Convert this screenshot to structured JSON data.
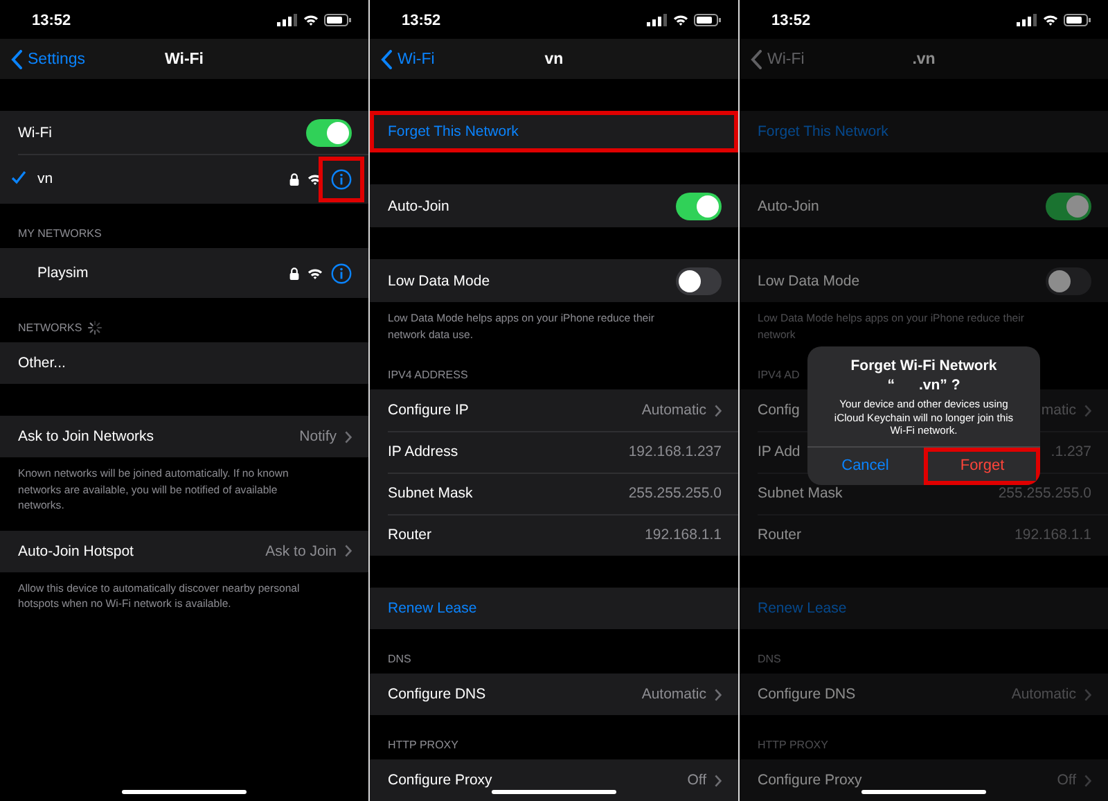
{
  "panels": [
    {
      "status": {
        "time": "13:52"
      },
      "nav": {
        "back": "Settings",
        "title": "Wi-Fi",
        "disabled": false
      },
      "dimmed": false,
      "sections": [
        {
          "rows": [
            {
              "kind": "toggle",
              "label": "Wi-Fi",
              "on": true
            },
            {
              "kind": "network",
              "label": "vn",
              "checked": true,
              "locked": true,
              "info_highlighted": true
            }
          ]
        },
        {
          "header": "MY NETWORKS",
          "rows": [
            {
              "kind": "network",
              "label": "Playsim",
              "checked": false,
              "locked": true,
              "info_highlighted": false
            }
          ]
        },
        {
          "header": "NETWORKS",
          "loading": true,
          "rows": [
            {
              "kind": "plain",
              "label": "Other..."
            }
          ]
        },
        {
          "rows": [
            {
              "kind": "nav",
              "label": "Ask to Join Networks",
              "value": "Notify"
            }
          ],
          "footer": "Known networks will be joined automatically. If no known\nnetworks are available, you will be notified of available\nnetworks."
        },
        {
          "rows": [
            {
              "kind": "nav",
              "label": "Auto-Join Hotspot",
              "value": "Ask to Join"
            }
          ],
          "footer": "Allow this device to automatically discover nearby personal\nhotspots when no Wi-Fi network is available."
        }
      ]
    },
    {
      "status": {
        "time": "13:52"
      },
      "nav": {
        "back": "Wi-Fi",
        "title": "vn",
        "disabled": false
      },
      "dimmed": false,
      "sections": [
        {
          "rows": [
            {
              "kind": "action",
              "label": "Forget This Network",
              "highlighted": true
            }
          ]
        },
        {
          "rows": [
            {
              "kind": "toggle",
              "label": "Auto-Join",
              "on": true
            }
          ]
        },
        {
          "rows": [
            {
              "kind": "toggle",
              "label": "Low Data Mode",
              "on": false
            }
          ],
          "footer": "Low Data Mode helps apps on your iPhone reduce their\nnetwork data use."
        },
        {
          "header": "IPV4 ADDRESS",
          "rows": [
            {
              "kind": "nav",
              "label": "Configure IP",
              "value": "Automatic"
            },
            {
              "kind": "value",
              "label": "IP Address",
              "value": "192.168.1.237"
            },
            {
              "kind": "value",
              "label": "Subnet Mask",
              "value": "255.255.255.0"
            },
            {
              "kind": "value",
              "label": "Router",
              "value": "192.168.1.1"
            }
          ]
        },
        {
          "rows": [
            {
              "kind": "action",
              "label": "Renew Lease",
              "highlighted": false
            }
          ]
        },
        {
          "header": "DNS",
          "rows": [
            {
              "kind": "nav",
              "label": "Configure DNS",
              "value": "Automatic"
            }
          ]
        },
        {
          "header": "HTTP PROXY",
          "rows": [
            {
              "kind": "nav",
              "label": "Configure Proxy",
              "value": "Off"
            }
          ]
        }
      ]
    },
    {
      "status": {
        "time": "13:52"
      },
      "nav": {
        "back": "Wi-Fi",
        "title": ".vn",
        "disabled": true
      },
      "dimmed": true,
      "sections": [
        {
          "rows": [
            {
              "kind": "action",
              "label": "Forget This Network",
              "highlighted": false
            }
          ]
        },
        {
          "rows": [
            {
              "kind": "toggle",
              "label": "Auto-Join",
              "on": true
            }
          ]
        },
        {
          "rows": [
            {
              "kind": "toggle",
              "label": "Low Data Mode",
              "on": false
            }
          ],
          "footer": "Low Data Mode helps apps on your iPhone reduce their\nnetwork"
        },
        {
          "header": "IPV4 AD",
          "rows": [
            {
              "kind": "nav",
              "label": "Config",
              "value": "matic"
            },
            {
              "kind": "value",
              "label": "IP Add",
              "value": ".1.237"
            },
            {
              "kind": "value",
              "label": "Subnet Mask",
              "value": "255.255.255.0"
            },
            {
              "kind": "value",
              "label": "Router",
              "value": "192.168.1.1"
            }
          ]
        },
        {
          "rows": [
            {
              "kind": "action",
              "label": "Renew Lease",
              "highlighted": false
            }
          ]
        },
        {
          "header": "DNS",
          "rows": [
            {
              "kind": "nav",
              "label": "Configure DNS",
              "value": "Automatic"
            }
          ]
        },
        {
          "header": "HTTP PROXY",
          "rows": [
            {
              "kind": "nav",
              "label": "Configure Proxy",
              "value": "Off"
            }
          ]
        }
      ],
      "alert": {
        "title": "Forget Wi-Fi Network",
        "name": "“      .vn” ?",
        "message": "Your device and other devices using\niCloud Keychain will no longer join this\nWi-Fi network.",
        "buttons": [
          {
            "kind": "cancel",
            "label": "Cancel",
            "highlighted": false
          },
          {
            "kind": "destructive",
            "label": "Forget",
            "highlighted": true
          }
        ]
      }
    }
  ]
}
